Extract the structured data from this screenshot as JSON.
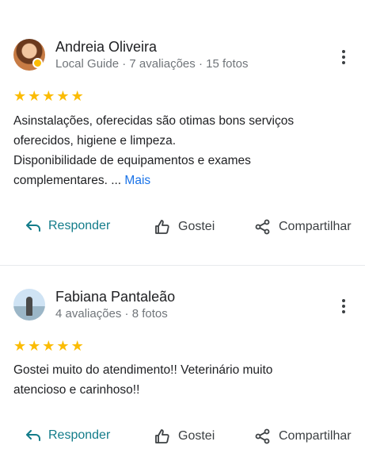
{
  "reviews": [
    {
      "name": "Andreia Oliveira",
      "meta": "Local Guide · 7 avaliações · 15 fotos",
      "stars": 5,
      "text": "Asinstalações, oferecidas são otimas bons serviços\noferecidos,  higiene e limpeza.\nDisponibilidade de equipamentos e exames\ncomplementares. ...",
      "more_label": "Mais",
      "reply_label": "Responder",
      "like_label": "Gostei",
      "share_label": "Compartilhar"
    },
    {
      "name": "Fabiana Pantaleão",
      "meta": "4 avaliações · 8 fotos",
      "stars": 5,
      "text": "Gostei muito do atendimento!! Veterinário muito\natencioso e carinhoso!!",
      "reply_label": "Responder",
      "like_label": "Gostei",
      "share_label": "Compartilhar"
    }
  ],
  "colors": {
    "star": "#fbbc04",
    "reply": "#137c8a",
    "link": "#1a73e8",
    "muted": "#70757a"
  },
  "icons": [
    "reply-icon",
    "thumbs-up-icon",
    "share-icon",
    "more-vert-icon",
    "star-icon",
    "local-guide-badge-icon"
  ]
}
